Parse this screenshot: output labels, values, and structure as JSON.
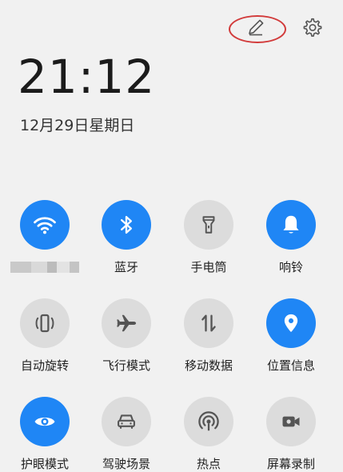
{
  "status": {
    "time": "21:12",
    "date": "12月29日星期日"
  },
  "header_actions": {
    "edit_icon": "pencil-icon",
    "settings_icon": "gear-icon"
  },
  "colors": {
    "active": "#1f86f5",
    "inactive": "#dcdcdc",
    "annotation": "#d23b3b"
  },
  "tiles": [
    {
      "id": "wifi",
      "label": "",
      "state": "on",
      "icon": "wifi-icon"
    },
    {
      "id": "bluetooth",
      "label": "蓝牙",
      "state": "on",
      "icon": "bluetooth-icon"
    },
    {
      "id": "flashlight",
      "label": "手电筒",
      "state": "off",
      "icon": "flashlight-icon"
    },
    {
      "id": "ring",
      "label": "响铃",
      "state": "on",
      "icon": "bell-icon"
    },
    {
      "id": "autorotate",
      "label": "自动旋转",
      "state": "off",
      "icon": "rotate-icon"
    },
    {
      "id": "airplane",
      "label": "飞行模式",
      "state": "off",
      "icon": "airplane-icon"
    },
    {
      "id": "mobile-data",
      "label": "移动数据",
      "state": "off",
      "icon": "data-arrows-icon"
    },
    {
      "id": "location",
      "label": "位置信息",
      "state": "on",
      "icon": "location-pin-icon"
    },
    {
      "id": "eye-care",
      "label": "护眼模式",
      "state": "on",
      "icon": "eye-icon"
    },
    {
      "id": "driving",
      "label": "驾驶场景",
      "state": "off",
      "icon": "car-icon"
    },
    {
      "id": "hotspot",
      "label": "热点",
      "state": "off",
      "icon": "hotspot-icon"
    },
    {
      "id": "screen-record",
      "label": "屏幕录制",
      "state": "off",
      "icon": "video-camera-icon"
    }
  ]
}
